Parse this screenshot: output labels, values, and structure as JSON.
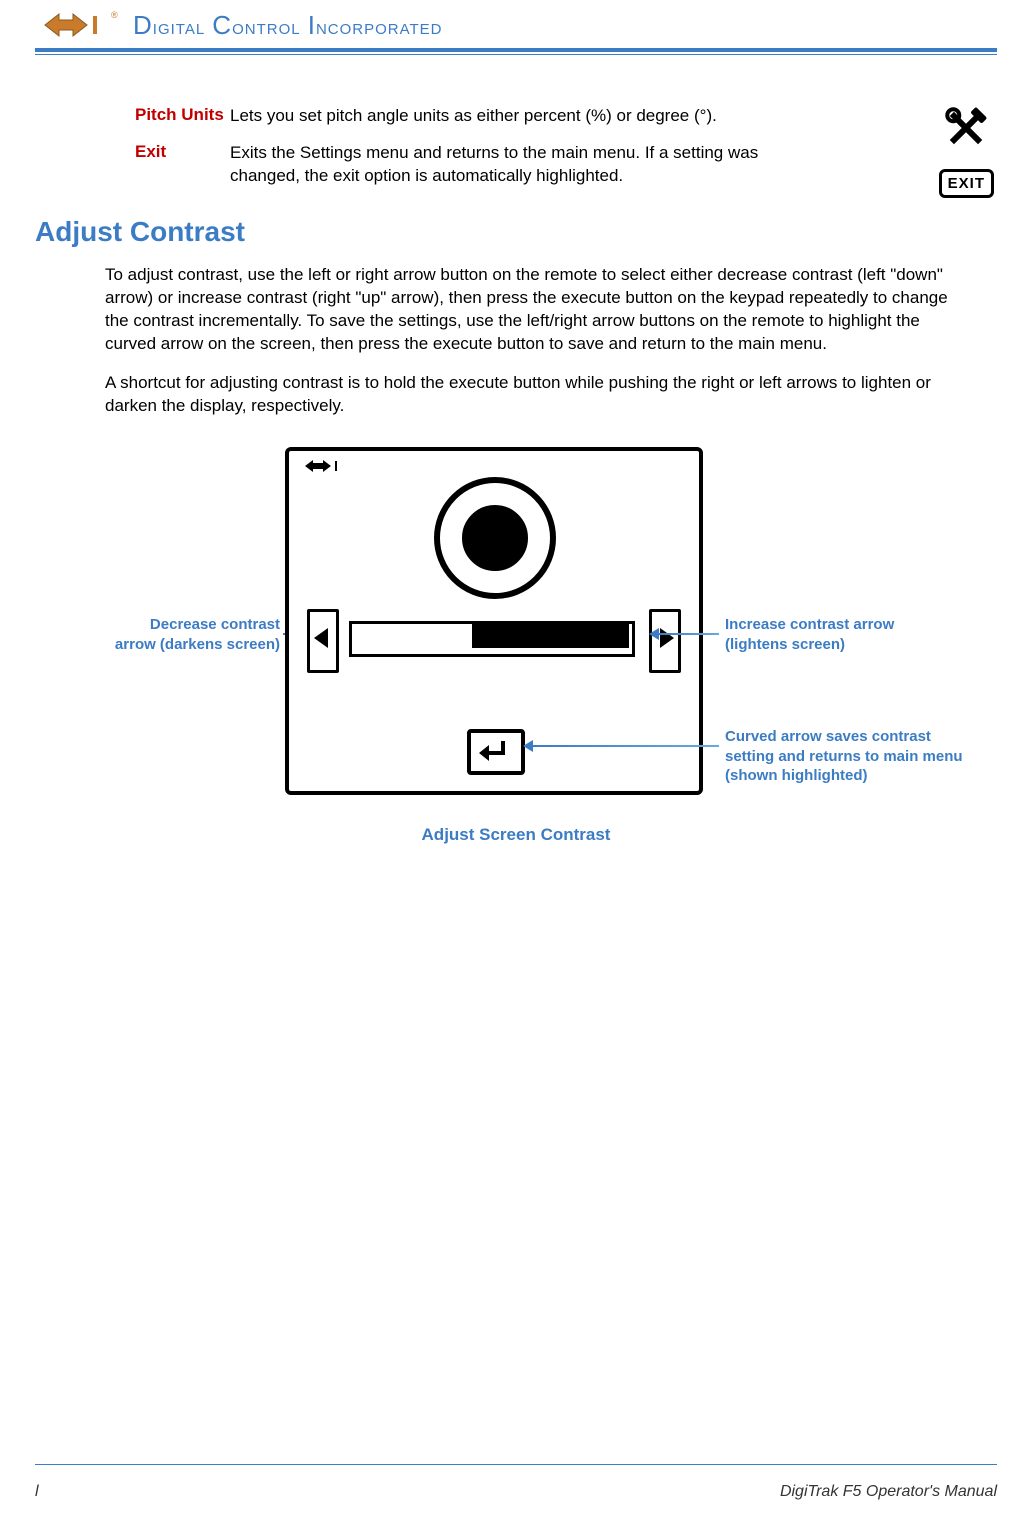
{
  "header": {
    "company": "DIGITAL CONTROL INCORPORATED"
  },
  "defs": [
    {
      "term": "Pitch Units",
      "text": "Lets you set pitch angle units as either percent (%) or degree (°)."
    },
    {
      "term": "Exit",
      "text": "Exits the Settings menu and returns to the main menu. If a setting was changed, the exit option is automatically highlighted."
    }
  ],
  "section": {
    "title": "Adjust Contrast",
    "p1": "To adjust contrast, use the left or right arrow button on the remote to select either decrease contrast (left \"down\" arrow) or increase contrast (right \"up\" arrow), then press the execute button on the keypad repeatedly to change the contrast incrementally. To save the settings, use the left/right arrow buttons on the remote to highlight the curved arrow on the screen, then press the execute button to save and return to the main menu.",
    "p2": "A shortcut for adjusting contrast is to hold the execute button while pushing the right or left arrows to lighten or darken the display, respectively."
  },
  "figure": {
    "callout_left": "Decrease contrast arrow (darkens screen)",
    "callout_right1": "Increase contrast arrow (lightens screen)",
    "callout_right2": "Curved arrow saves contrast setting and returns to main menu (shown highlighted)",
    "caption": "Adjust Screen Contrast"
  },
  "icons": {
    "tools": "tools-icon",
    "exit": "EXIT"
  },
  "footer": {
    "left": "l",
    "right": "DigiTrak F5 Operator's Manual"
  }
}
